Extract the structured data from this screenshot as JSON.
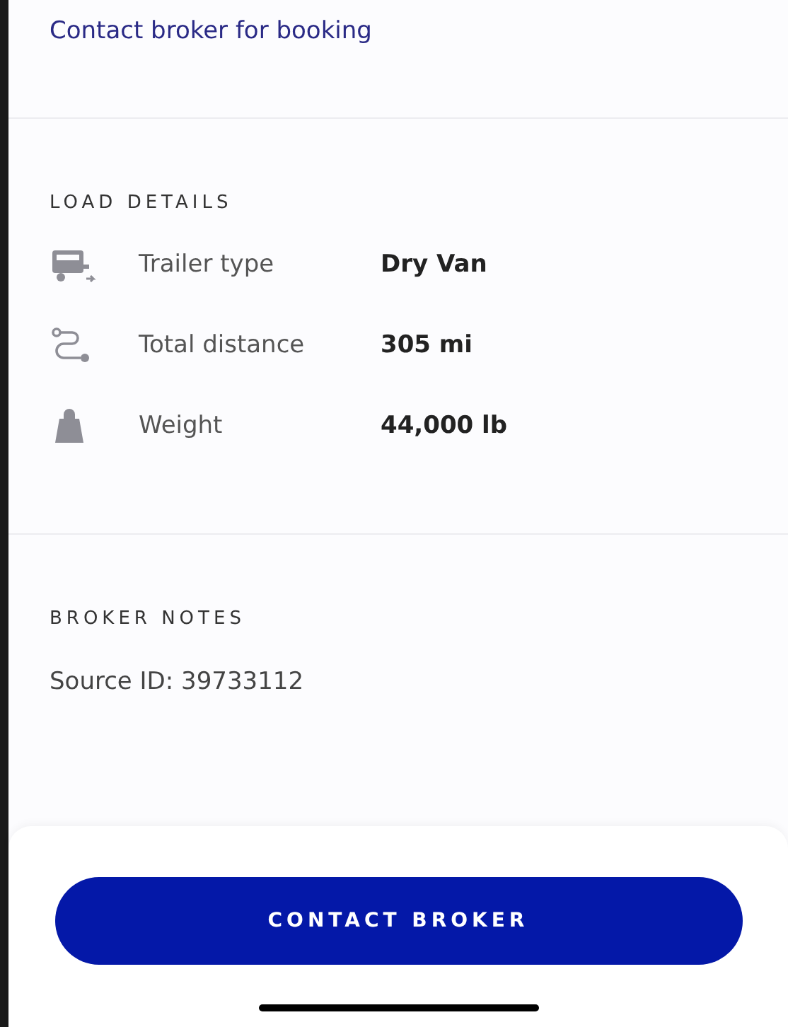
{
  "booking_link": "Contact broker for booking",
  "load_details": {
    "title": "LOAD DETAILS",
    "rows": [
      {
        "kind": "trailer",
        "label": "Trailer type",
        "value": "Dry Van"
      },
      {
        "kind": "distance",
        "label": "Total distance",
        "value": "305 mi"
      },
      {
        "kind": "weight",
        "label": "Weight",
        "value": "44,000 lb"
      }
    ]
  },
  "broker_notes": {
    "title": "BROKER NOTES",
    "text": "Source ID: 39733112"
  },
  "contact_button": "CONTACT BROKER"
}
